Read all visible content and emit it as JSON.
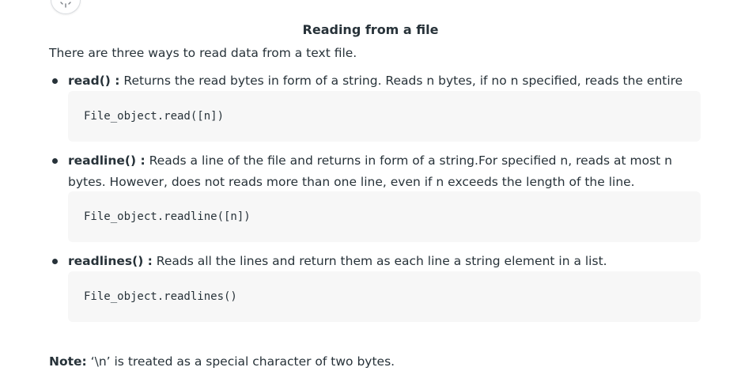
{
  "title": "Reading from a file",
  "intro": "There are three ways to read data from a text file.",
  "methods": [
    {
      "name": "read() :",
      "description": " Returns the read bytes in form of a string. Reads n bytes, if no n specified, reads the entire file.",
      "code": "File_object.read([n])"
    },
    {
      "name": "readline() :",
      "description": " Reads a line of the file and returns in form of a string.For specified n, reads at most n bytes. However, does not reads more than one line, even if n exceeds the length of the line.",
      "code": "File_object.readline([n])"
    },
    {
      "name": "readlines() :",
      "description": " Reads all the lines and return them as each line a string element in a list.",
      "code": "File_object.readlines()"
    }
  ],
  "note": {
    "label": "Note:",
    "text": " ‘\\n’ is treated as a special character of two bytes."
  },
  "icons": {
    "loader": "loading-spinner-icon"
  }
}
